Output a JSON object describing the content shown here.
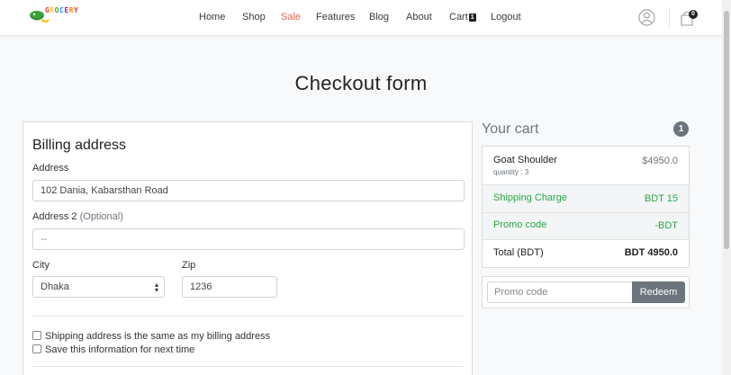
{
  "brand": {
    "logo_text": "GROCERY",
    "logo_letter_colors": [
      "#e53935",
      "#fbc02d",
      "#43a047",
      "#1e88e5",
      "#8e24aa",
      "#fb8c00",
      "#e53935"
    ]
  },
  "nav": {
    "items": [
      {
        "label": "Home"
      },
      {
        "label": "Shop"
      },
      {
        "label": "Sale"
      },
      {
        "label": "Features"
      },
      {
        "label": "Blog"
      },
      {
        "label": "About"
      },
      {
        "label": "Cart"
      },
      {
        "label": "Logout"
      }
    ],
    "cart_count": "1",
    "bag_count": "0",
    "active_color": "#e8634e"
  },
  "page": {
    "title": "Checkout form"
  },
  "billing": {
    "title": "Billing address",
    "address_label": "Address",
    "address_value": "102 Dania, Kabarsthan Road",
    "address2_label": "Address 2",
    "address2_optional": "(Optional)",
    "address2_value": "--",
    "city_label": "City",
    "city_value": "Dhaka",
    "zip_label": "Zip",
    "zip_value": "1236",
    "same_address_label": "Shipping address is the same as my billing address",
    "save_info_label": "Save this information for next time"
  },
  "cart": {
    "title": "Your cart",
    "count": "1",
    "item_name": "Goat Shoulder",
    "item_quantity": "quantity : 3",
    "item_price": "$4950.0",
    "shipping_label": "Shipping Charge",
    "shipping_value": "BDT 15",
    "promo_label": "Promo code",
    "promo_value": "-BDT",
    "total_label": "Total (BDT)",
    "total_value": "BDT 4950.0",
    "promo_placeholder": "Promo code",
    "redeem_label": "Redeem",
    "success_color": "#28a745",
    "badge_color": "#6c757d"
  }
}
